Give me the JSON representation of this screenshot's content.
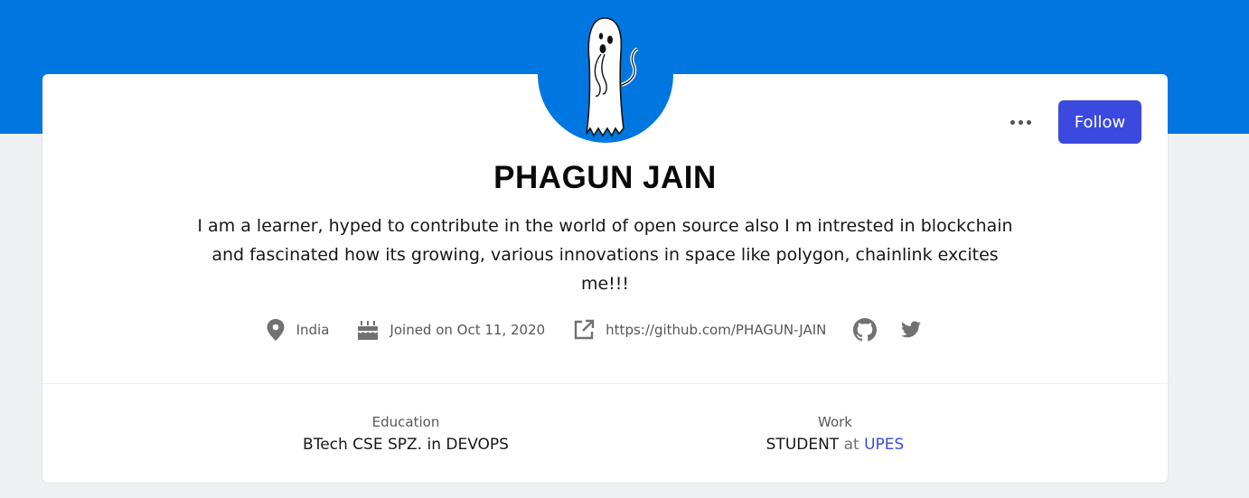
{
  "profile": {
    "name": "PHAGUN JAIN",
    "bio": "I am a learner, hyped to contribute in the world of open source also I m intrested in blockchain and fascinated how its growing, various innovations in space like polygon, chainlink excites me!!!",
    "follow_label": "Follow",
    "location": "India",
    "joined": "Joined on Oct 11, 2020",
    "website": "https://github.com/PHAGUN-JAIN"
  },
  "details": {
    "education_label": "Education",
    "education_value": "BTech CSE SPZ. in DEVOPS",
    "work_label": "Work",
    "work_role": "STUDENT",
    "work_at": "at",
    "work_org": "UPES"
  },
  "icons": [
    "more-icon",
    "location-pin-icon",
    "cake-icon",
    "external-link-icon",
    "github-icon",
    "twitter-icon"
  ],
  "colors": {
    "banner": "#0077e0",
    "follow_button": "#3b49df",
    "icon": "#717171",
    "page_bg": "#eef0f1"
  }
}
